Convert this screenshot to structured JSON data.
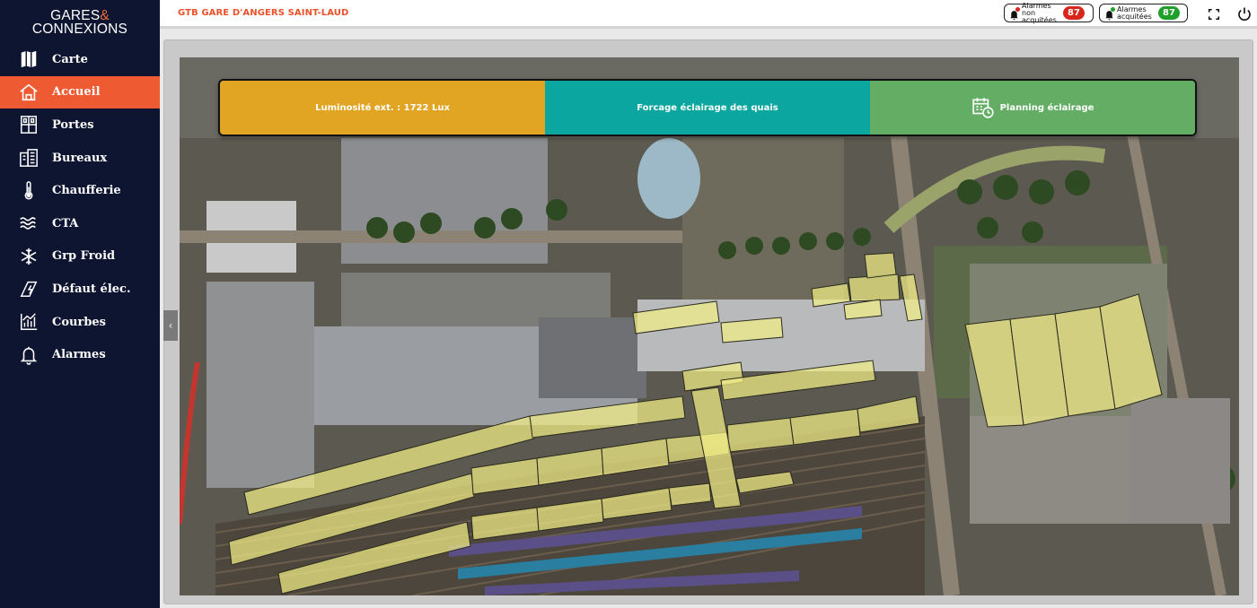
{
  "logo": {
    "line1": "GARES",
    "amp": "&",
    "line2": "CONNEXIONS"
  },
  "header": {
    "title": "GTB GARE D'ANGERS SAINT-LAUD"
  },
  "alarms": {
    "non_ack": {
      "line1": "Alarmes non",
      "line2": "acquitées",
      "count": "87",
      "color": "#d9261c"
    },
    "ack": {
      "line1": "Alarmes",
      "line2": "acquitées",
      "count": "87",
      "color": "#1fa02b"
    }
  },
  "sidebar": {
    "items": [
      {
        "label": "Carte",
        "icon": "map-icon"
      },
      {
        "label": "Accueil",
        "icon": "home-icon",
        "active": true
      },
      {
        "label": "Portes",
        "icon": "door-icon"
      },
      {
        "label": "Bureaux",
        "icon": "office-icon"
      },
      {
        "label": "Chaufferie",
        "icon": "thermometer-icon"
      },
      {
        "label": "CTA",
        "icon": "air-waves-icon"
      },
      {
        "label": "Grp Froid",
        "icon": "snowflake-icon"
      },
      {
        "label": "Défaut élec.",
        "icon": "electric-fault-icon"
      },
      {
        "label": "Courbes",
        "icon": "chart-icon"
      },
      {
        "label": "Alarmes",
        "icon": "bell-icon"
      }
    ]
  },
  "controls": {
    "luminosity": "Luminosité ext. : 1722 Lux",
    "forcing": "Forcage éclairage des quais",
    "planning": "Planning éclairage"
  },
  "colors": {
    "sidebar_bg": "#0e1530",
    "accent": "#ee5a32",
    "title": "#e8512a",
    "lux_btn": "#e1a423",
    "force_btn": "#0ca6a0",
    "plan_btn": "#63ae64",
    "zone_fill": "#f3ee86"
  }
}
